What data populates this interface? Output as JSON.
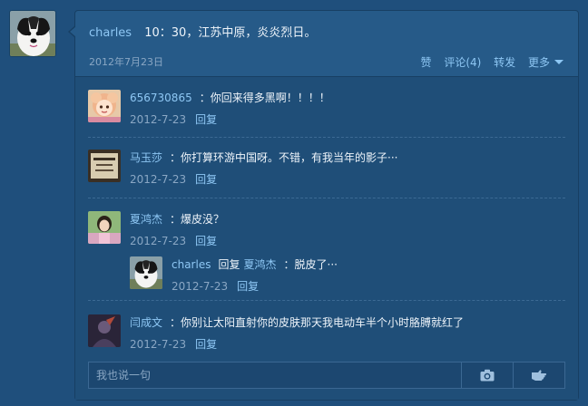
{
  "post": {
    "author": "charles",
    "text": "10：30，江苏中原，炎炎烈日。",
    "date": "2012年7月23日",
    "actions": {
      "like": "赞",
      "comment": "评论(4)",
      "repost": "转发",
      "more": "更多"
    }
  },
  "comments": [
    {
      "author": "656730865",
      "text": "：你回来得多黑啊！！！！",
      "date": "2012-7-23",
      "reply": "回复",
      "avatar_icon": "cartoon-girl-avatar"
    },
    {
      "author": "马玉莎",
      "text": "：你打算环游中国呀。不错，有我当年的影子···",
      "date": "2012-7-23",
      "reply": "回复",
      "avatar_icon": "calligraphy-avatar"
    },
    {
      "author": "夏鸿杰",
      "text": "：爆皮没？",
      "date": "2012-7-23",
      "reply": "回复",
      "avatar_icon": "girl-photo-avatar"
    },
    {
      "author": "闫成文",
      "text": "：你别让太阳直射你的皮肤那天我电动车半个小时胳膊就红了",
      "date": "2012-7-23",
      "reply": "回复",
      "avatar_icon": "dark-figure-avatar"
    }
  ],
  "nested_reply": {
    "author": "charles",
    "reply_word": "回复",
    "target": "夏鸿杰",
    "text": "：脱皮了···",
    "date": "2012-7-23",
    "reply": "回复"
  },
  "comment_box": {
    "placeholder": "我也说一句",
    "camera_icon": "camera-icon",
    "hand_icon": "pointing-hand-icon"
  },
  "colors": {
    "background": "#1f4f7c",
    "card": "#265a88",
    "link": "#8ec7f4",
    "muted": "#8aa7c4"
  }
}
